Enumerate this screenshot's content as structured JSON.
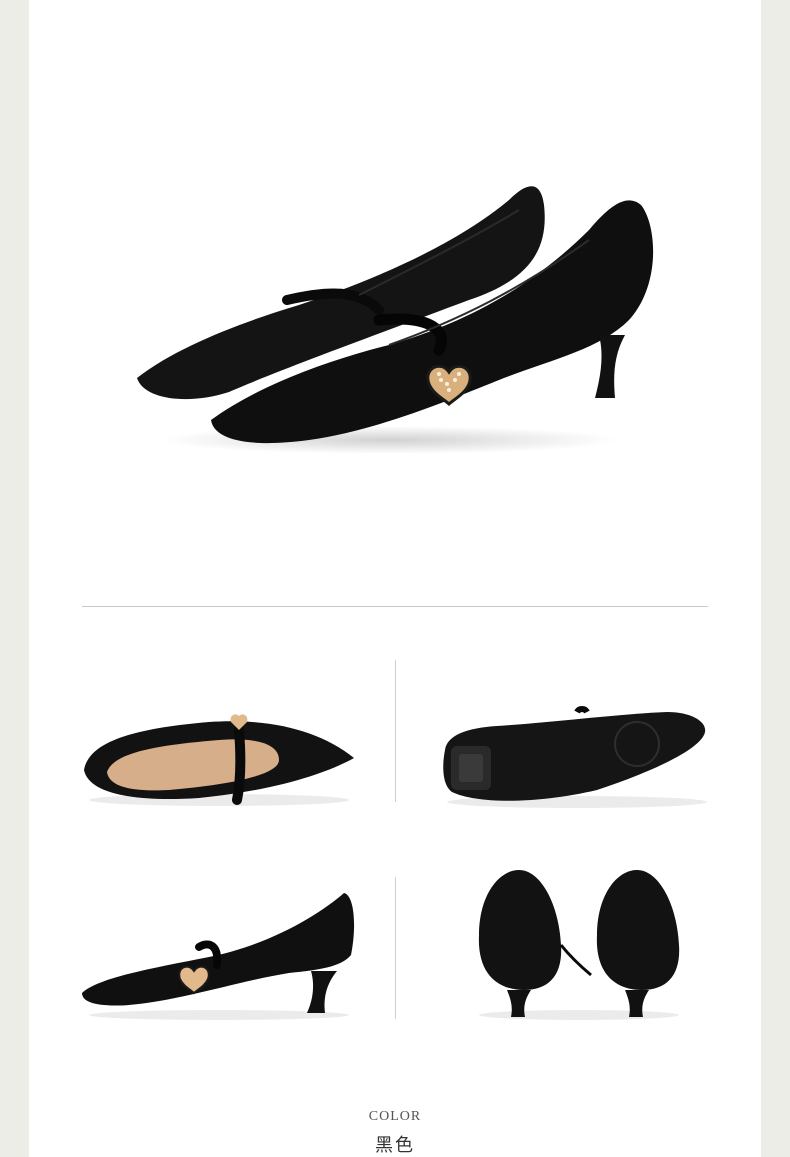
{
  "product": {
    "color_heading": "COLOR",
    "color_name": "黑色"
  },
  "images": {
    "hero": "black-suede-pointed-pump-pair",
    "views": [
      "inside-view",
      "sole-view",
      "side-view",
      "back-view"
    ]
  },
  "colors": {
    "shoe": "#111111",
    "lining": "#d7ae8a",
    "accent_gold": "#e2b98a",
    "pearl": "#f4efe4"
  }
}
